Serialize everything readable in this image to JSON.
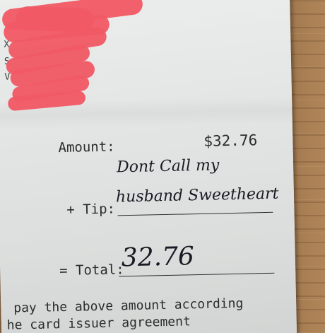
{
  "receipt": {
    "edge_letters": [
      "X",
      "S",
      "V"
    ],
    "amount_label": "Amount:",
    "amount_value": "$32.76",
    "tip_label": "+ Tip:",
    "tip_note_line1": "Dont Call my",
    "tip_note_line2": "husband Sweetheart",
    "total_label": "= Total:",
    "total_value": "32.76",
    "footer_line1": "pay the above amount according",
    "footer_line2": "he card issuer agreement"
  },
  "colors": {
    "redaction": "#f05a65",
    "paper": "#e4e6e6",
    "table_wood": "#9a7550"
  }
}
